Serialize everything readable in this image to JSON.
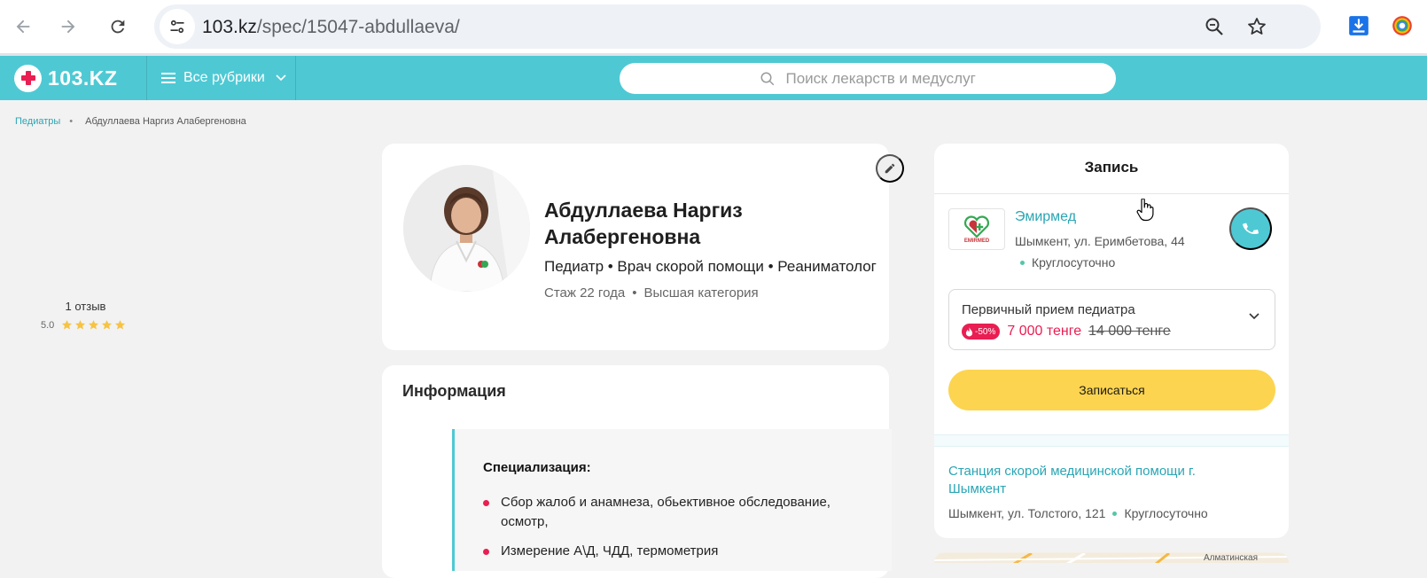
{
  "browser": {
    "url_host": "103.kz",
    "url_path": "/spec/15047-abdullaeva/"
  },
  "site": {
    "logo_text": "103.KZ",
    "rubrics_label": "Все рубрики",
    "search_placeholder": "Поиск лекарств и медуслуг"
  },
  "breadcrumb": {
    "parent": "Педиатры",
    "current": "Абдуллаева Наргиз Алабергеновна"
  },
  "doctor": {
    "name": "Абдуллаева Наргиз Алабергеновна",
    "specialties": "Педиатр • Врач скорой помощи • Реаниматолог",
    "experience": "Стаж 22 года",
    "category": "Высшая категория",
    "reviews": "1 отзыв",
    "rating": "5.0",
    "rating_stars": 5
  },
  "info": {
    "title": "Информация",
    "spec_heading": "Специализация:",
    "items": [
      "Сбор жалоб и анамнеза, обьективное обследование, осмотр,",
      "Измерение А\\Д, ЧДД, термометрия"
    ]
  },
  "booking": {
    "title": "Запись",
    "clinic": {
      "logo_caption": "EMIRMED",
      "name": "Эмирмед",
      "address": "Шымкент, ул. Еримбетова, 44",
      "hours": "Круглосуточно"
    },
    "service": {
      "name": "Первичный прием педиатра",
      "discount": "-50%",
      "price_new": "7 000 тенге",
      "price_old": "14 000 тенге"
    },
    "book_label": "Записаться",
    "station": {
      "name": "Станция скорой медицинской помощи г. Шымкент",
      "address": "Шымкент, ул. Толстого, 121",
      "hours": "Круглосуточно"
    }
  },
  "map": {
    "label": "Алматинская"
  },
  "colors": {
    "brand": "#4ec9d4",
    "accent_pink": "#e91e52",
    "button_yellow": "#fdd44f",
    "link": "#2aa5b4",
    "star": "#f6c343"
  }
}
